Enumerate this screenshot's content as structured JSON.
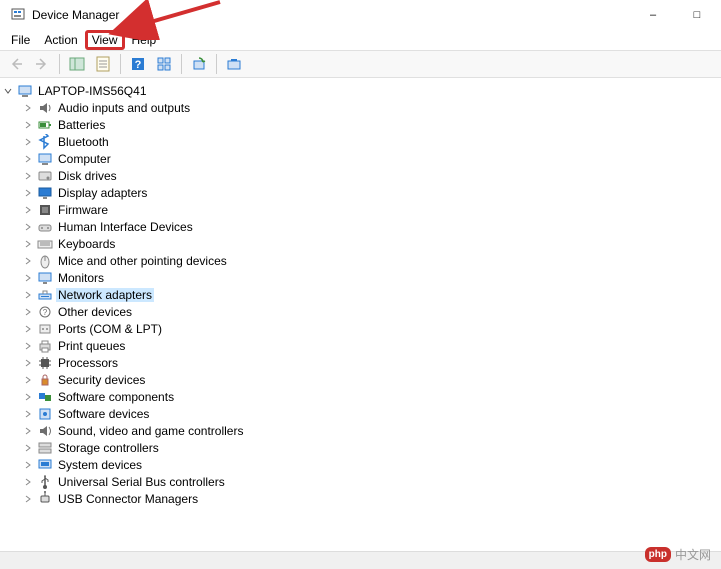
{
  "window": {
    "title": "Device Manager",
    "minimize": "–",
    "maximize": "□",
    "close": "✕"
  },
  "menu": {
    "items": [
      {
        "label": "File",
        "highlighted": false
      },
      {
        "label": "Action",
        "highlighted": false
      },
      {
        "label": "View",
        "highlighted": true
      },
      {
        "label": "Help",
        "highlighted": false
      }
    ]
  },
  "toolbar": {
    "buttons": [
      {
        "name": "back",
        "enabled": false
      },
      {
        "name": "forward",
        "enabled": false
      },
      {
        "name": "show-hide-tree",
        "enabled": true
      },
      {
        "name": "properties",
        "enabled": true
      },
      {
        "name": "help",
        "enabled": true
      },
      {
        "name": "icon-view",
        "enabled": true
      },
      {
        "name": "scan-hardware",
        "enabled": true
      },
      {
        "name": "add-legacy",
        "enabled": true
      }
    ]
  },
  "tree": {
    "root": {
      "label": "LAPTOP-IMS56Q41",
      "expanded": true
    },
    "categories": [
      {
        "label": "Audio inputs and outputs",
        "icon": "audio",
        "expanded": false,
        "selected": false
      },
      {
        "label": "Batteries",
        "icon": "battery",
        "expanded": false,
        "selected": false
      },
      {
        "label": "Bluetooth",
        "icon": "bluetooth",
        "expanded": false,
        "selected": false
      },
      {
        "label": "Computer",
        "icon": "computer",
        "expanded": false,
        "selected": false
      },
      {
        "label": "Disk drives",
        "icon": "disk",
        "expanded": false,
        "selected": false
      },
      {
        "label": "Display adapters",
        "icon": "display",
        "expanded": false,
        "selected": false
      },
      {
        "label": "Firmware",
        "icon": "firmware",
        "expanded": false,
        "selected": false
      },
      {
        "label": "Human Interface Devices",
        "icon": "hid",
        "expanded": false,
        "selected": false
      },
      {
        "label": "Keyboards",
        "icon": "keyboard",
        "expanded": false,
        "selected": false
      },
      {
        "label": "Mice and other pointing devices",
        "icon": "mouse",
        "expanded": false,
        "selected": false
      },
      {
        "label": "Monitors",
        "icon": "monitor",
        "expanded": false,
        "selected": false
      },
      {
        "label": "Network adapters",
        "icon": "network",
        "expanded": false,
        "selected": true
      },
      {
        "label": "Other devices",
        "icon": "other",
        "expanded": false,
        "selected": false
      },
      {
        "label": "Ports (COM & LPT)",
        "icon": "port",
        "expanded": false,
        "selected": false
      },
      {
        "label": "Print queues",
        "icon": "printer",
        "expanded": false,
        "selected": false
      },
      {
        "label": "Processors",
        "icon": "cpu",
        "expanded": false,
        "selected": false
      },
      {
        "label": "Security devices",
        "icon": "security",
        "expanded": false,
        "selected": false
      },
      {
        "label": "Software components",
        "icon": "sw-comp",
        "expanded": false,
        "selected": false
      },
      {
        "label": "Software devices",
        "icon": "sw-dev",
        "expanded": false,
        "selected": false
      },
      {
        "label": "Sound, video and game controllers",
        "icon": "sound",
        "expanded": false,
        "selected": false
      },
      {
        "label": "Storage controllers",
        "icon": "storage",
        "expanded": false,
        "selected": false
      },
      {
        "label": "System devices",
        "icon": "system",
        "expanded": false,
        "selected": false
      },
      {
        "label": "Universal Serial Bus controllers",
        "icon": "usb",
        "expanded": false,
        "selected": false
      },
      {
        "label": "USB Connector Managers",
        "icon": "usb-conn",
        "expanded": false,
        "selected": false
      }
    ]
  },
  "watermark": {
    "logo": "php",
    "text": "中文网"
  },
  "icons": {
    "palette": {
      "blue": "#2b7cd3",
      "gray": "#6e6e6e",
      "green": "#3a8f3a",
      "orange": "#d98b2b",
      "purple": "#7a4fb5"
    }
  }
}
